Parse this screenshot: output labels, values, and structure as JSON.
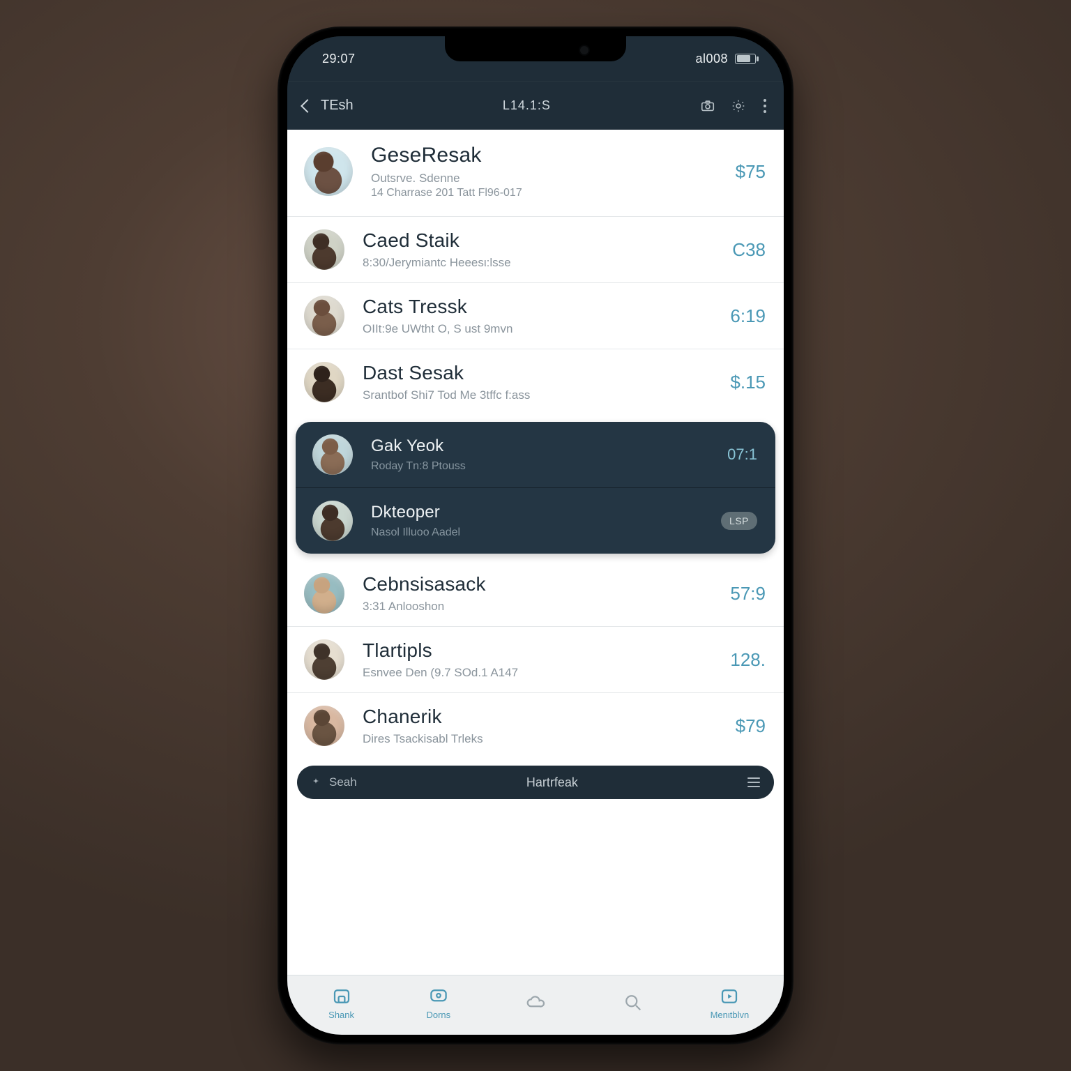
{
  "status": {
    "time": "29:07",
    "right_text": "al008"
  },
  "header": {
    "back_label": "TEsh",
    "title": "L14.1:S"
  },
  "contacts": [
    {
      "name": "GeseResak",
      "line1": "Outsrve. Sdenne",
      "line2": "14 Charrase 201 Tatt Fl96-017",
      "trail": "$75",
      "style": "tall big",
      "av": "s1"
    },
    {
      "name": "Caed Staik",
      "line1": "8:30/Jerymiantc Heeesι:lsse",
      "trail": "C38",
      "av": "s2"
    },
    {
      "name": "Cats Tressk",
      "line1": "OIIt:9e UWtht O, S ust 9mvn",
      "trail": "6:19",
      "av": "s3"
    },
    {
      "name": "Dast Sesak",
      "line1": "Srantbof Shi7 Tod Me 3tffc f:ass",
      "trail": "$.15",
      "av": "s4"
    }
  ],
  "dark_rows": [
    {
      "name": "Gak Yeok",
      "line1": "Roday Tn:8 Ptouss",
      "trail": "07:1",
      "av": "s5"
    },
    {
      "name": "Dkteoper",
      "line1": "Nasol Illuoo Aadel",
      "pill": "LSP",
      "av": "s6"
    }
  ],
  "contacts_after": [
    {
      "name": "Cebnsisasack",
      "line1": "3:31 Anlooshon",
      "trail": "57:9",
      "av": "s7"
    },
    {
      "name": "Tlartipls",
      "line1": "Esnvee Den (9.7 SOd.1 A147",
      "trail": "128.",
      "av": "s8"
    },
    {
      "name": "Chanerik",
      "line1": "Dires Tsackisabl Trleks",
      "trail": "$79",
      "av": "s9"
    }
  ],
  "searchbar": {
    "left": "Seah",
    "center": "Hartrfeak"
  },
  "tabs": [
    {
      "label": "Shank",
      "icon": "home"
    },
    {
      "label": "Dorns",
      "icon": "chat"
    },
    {
      "label": "",
      "icon": "cloud"
    },
    {
      "label": "",
      "icon": "search"
    },
    {
      "label": "Menιtblvn",
      "icon": "play"
    }
  ]
}
